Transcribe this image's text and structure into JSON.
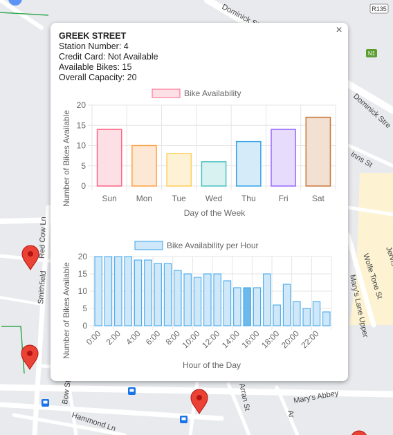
{
  "map": {
    "streets": [
      "Dominick St",
      "Dominick Stre",
      "Inns St",
      "Red Cow Ln",
      "Smithfield",
      "Wolfe Tone St",
      "Jervis St",
      "Mary's Abbey",
      "Hammond Ln",
      "Bow St",
      "Arran St",
      "Ar",
      "Mary's Lane Upper"
    ],
    "road_badges": [
      "R135",
      "N1"
    ],
    "colors": {
      "pin": "#ea4335",
      "background": "#e8eaed",
      "road": "#ffffff",
      "highlight": "#fdf3d3",
      "badge_green": "#5c9e31"
    }
  },
  "popup": {
    "close_label": "×",
    "station_name": "GREEK STREET",
    "station_number": "Station Number: 4",
    "credit_card": "Credit Card: Not Available",
    "available_bikes": "Available Bikes: 15",
    "overall_capacity": "Overall Capacity: 20"
  },
  "chart_data": [
    {
      "type": "bar",
      "legend": "Bike Availability",
      "xlabel": "Day of the Week",
      "ylabel": "Number of Bikes Available",
      "categories": [
        "Sun",
        "Mon",
        "Tue",
        "Wed",
        "Thu",
        "Fri",
        "Sat"
      ],
      "values": [
        14,
        10,
        8,
        6,
        11,
        14,
        17
      ],
      "ylim": [
        0,
        20
      ],
      "yticks": [
        0,
        5,
        10,
        15,
        20
      ],
      "colors": [
        {
          "fill": "#fde0e6",
          "stroke": "#ff6384"
        },
        {
          "fill": "#fde8d6",
          "stroke": "#ff9f40"
        },
        {
          "fill": "#fdf2d5",
          "stroke": "#ffcd56"
        },
        {
          "fill": "#d8f2f2",
          "stroke": "#4bc0c0"
        },
        {
          "fill": "#d6ebf9",
          "stroke": "#36a2eb"
        },
        {
          "fill": "#e8dcfd",
          "stroke": "#9966ff"
        },
        {
          "fill": "#f2e0d2",
          "stroke": "#c9773a"
        }
      ],
      "grid": true,
      "legend_position": "top"
    },
    {
      "type": "bar",
      "legend": "Bike Availability per Hour",
      "xlabel": "Hour of the Day",
      "ylabel": "Number of Bikes Available",
      "categories": [
        "0:00",
        "1:00",
        "2:00",
        "3:00",
        "4:00",
        "5:00",
        "6:00",
        "7:00",
        "8:00",
        "9:00",
        "10:00",
        "11:00",
        "12:00",
        "13:00",
        "14:00",
        "15:00",
        "16:00",
        "17:00",
        "18:00",
        "19:00",
        "20:00",
        "21:00",
        "22:00",
        "23:00"
      ],
      "tick_labels": [
        "0:00",
        "2:00",
        "4:00",
        "6:00",
        "8:00",
        "10:00",
        "12:00",
        "14:00",
        "16:00",
        "18:00",
        "20:00",
        "22:00"
      ],
      "values": [
        20,
        20,
        20,
        20,
        19,
        19,
        18,
        18,
        16,
        15,
        14,
        15,
        15,
        13,
        11,
        11,
        11,
        15,
        6,
        12,
        7,
        5,
        7,
        4
      ],
      "highlighted_index": 15,
      "ylim": [
        0,
        20
      ],
      "yticks": [
        0,
        5,
        10,
        15,
        20
      ],
      "colors": {
        "fill": "#cfe8f9",
        "stroke": "#36a2eb",
        "highlight_fill": "#6db8ec"
      },
      "grid": true,
      "legend_position": "top"
    }
  ]
}
